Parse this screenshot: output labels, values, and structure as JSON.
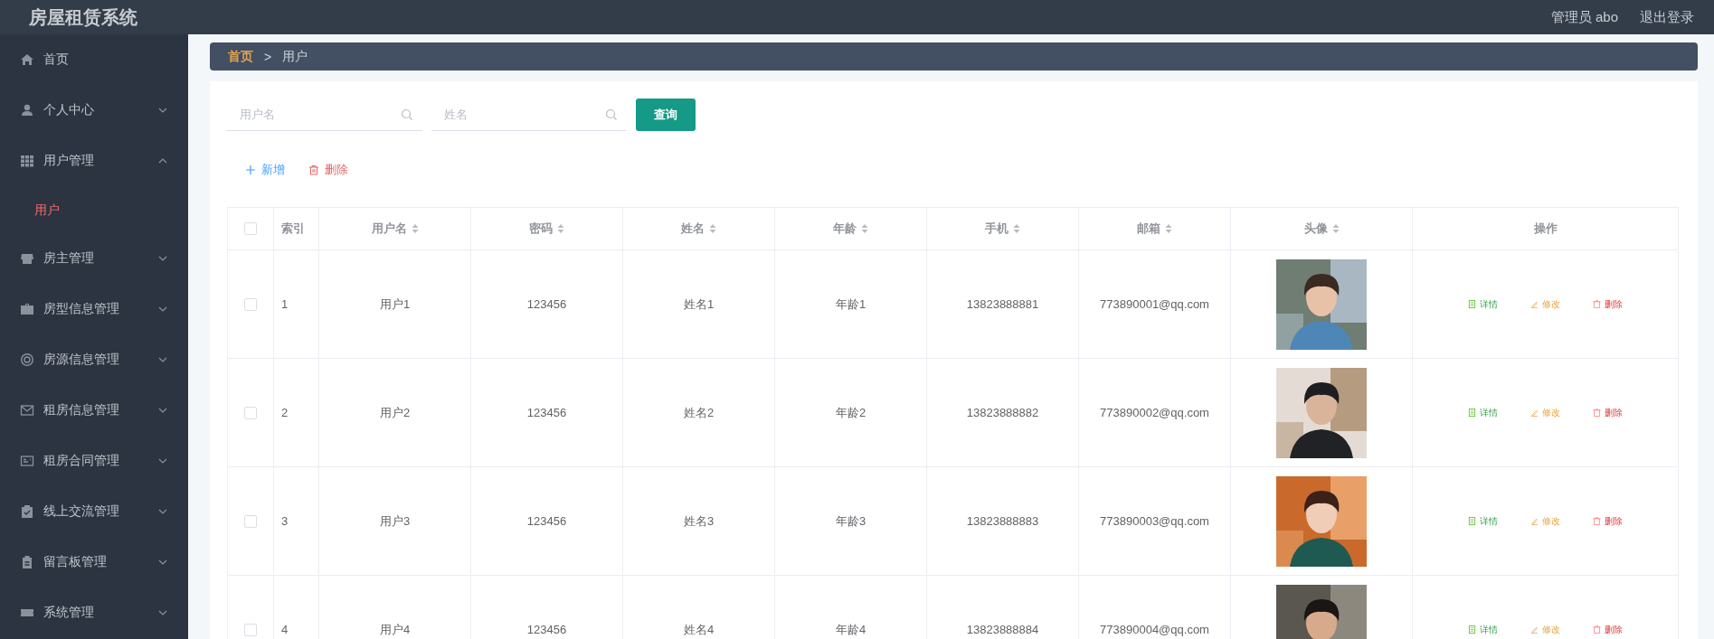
{
  "header": {
    "title": "房屋租赁系统",
    "user": "管理员 abo",
    "logout": "退出登录"
  },
  "sidebar": {
    "items": [
      {
        "label": "首页",
        "kind": "link"
      },
      {
        "label": "个人中心",
        "kind": "menu",
        "expanded": false
      },
      {
        "label": "用户管理",
        "kind": "menu",
        "expanded": true,
        "children": [
          {
            "label": "用户",
            "selected": true
          }
        ]
      },
      {
        "label": "房主管理",
        "kind": "menu",
        "expanded": false
      },
      {
        "label": "房型信息管理",
        "kind": "menu",
        "expanded": false
      },
      {
        "label": "房源信息管理",
        "kind": "menu",
        "expanded": false
      },
      {
        "label": "租房信息管理",
        "kind": "menu",
        "expanded": false
      },
      {
        "label": "租房合同管理",
        "kind": "menu",
        "expanded": false
      },
      {
        "label": "线上交流管理",
        "kind": "menu",
        "expanded": false
      },
      {
        "label": "留言板管理",
        "kind": "menu",
        "expanded": false
      },
      {
        "label": "系统管理",
        "kind": "menu",
        "expanded": false
      }
    ]
  },
  "breadcrumb": [
    {
      "label": "首页",
      "selected": false
    },
    {
      "label": ">",
      "kind": "separator"
    },
    {
      "label": "用户",
      "selected": true
    }
  ],
  "search": {
    "fields": [
      {
        "placeholder": "用户名"
      },
      {
        "placeholder": "姓名"
      }
    ],
    "button": "查询"
  },
  "toolbar": [
    {
      "label": "新增",
      "kind": "add"
    },
    {
      "label": "删除",
      "kind": "delete"
    }
  ],
  "table": {
    "columns": [
      {
        "kind": "checkbox",
        "checked": false
      },
      {
        "label": "索引",
        "sortable": false
      },
      {
        "label": "用户名",
        "sortable": true
      },
      {
        "label": "密码",
        "sortable": true
      },
      {
        "label": "姓名",
        "sortable": true
      },
      {
        "label": "年龄",
        "sortable": true
      },
      {
        "label": "手机",
        "sortable": true
      },
      {
        "label": "邮箱",
        "sortable": true
      },
      {
        "label": "头像",
        "sortable": true
      },
      {
        "label": "操作",
        "sortable": false
      }
    ],
    "rows": [
      {
        "checked": false,
        "index": "1",
        "username": "用户1",
        "password": "123456",
        "name": "姓名1",
        "age": "年龄1",
        "phone": "13823888881",
        "email": "773890001@qq.com",
        "avatar": {
          "kind": "picture"
        },
        "actions": [
          {
            "label": "详情",
            "kind": "detail"
          },
          {
            "label": "修改",
            "kind": "edit"
          },
          {
            "label": "删除",
            "kind": "delete"
          }
        ]
      },
      {
        "checked": false,
        "index": "2",
        "username": "用户2",
        "password": "123456",
        "name": "姓名2",
        "age": "年龄2",
        "phone": "13823888882",
        "email": "773890002@qq.com",
        "avatar": {
          "kind": "picture"
        },
        "actions": [
          {
            "label": "详情",
            "kind": "detail"
          },
          {
            "label": "修改",
            "kind": "edit"
          },
          {
            "label": "删除",
            "kind": "delete"
          }
        ]
      },
      {
        "checked": false,
        "index": "3",
        "username": "用户3",
        "password": "123456",
        "name": "姓名3",
        "age": "年龄3",
        "phone": "13823888883",
        "email": "773890003@qq.com",
        "avatar": {
          "kind": "picture"
        },
        "actions": [
          {
            "label": "详情",
            "kind": "detail"
          },
          {
            "label": "修改",
            "kind": "edit"
          },
          {
            "label": "删除",
            "kind": "delete"
          }
        ]
      },
      {
        "checked": false,
        "index": "4",
        "username": "用户4",
        "password": "123456",
        "name": "姓名4",
        "age": "年龄4",
        "phone": "13823888884",
        "email": "773890004@qq.com",
        "avatar": {
          "kind": "picture"
        },
        "actions": [
          {
            "label": "详情",
            "kind": "detail"
          },
          {
            "label": "修改",
            "kind": "edit"
          },
          {
            "label": "删除",
            "kind": "delete"
          }
        ]
      }
    ]
  }
}
